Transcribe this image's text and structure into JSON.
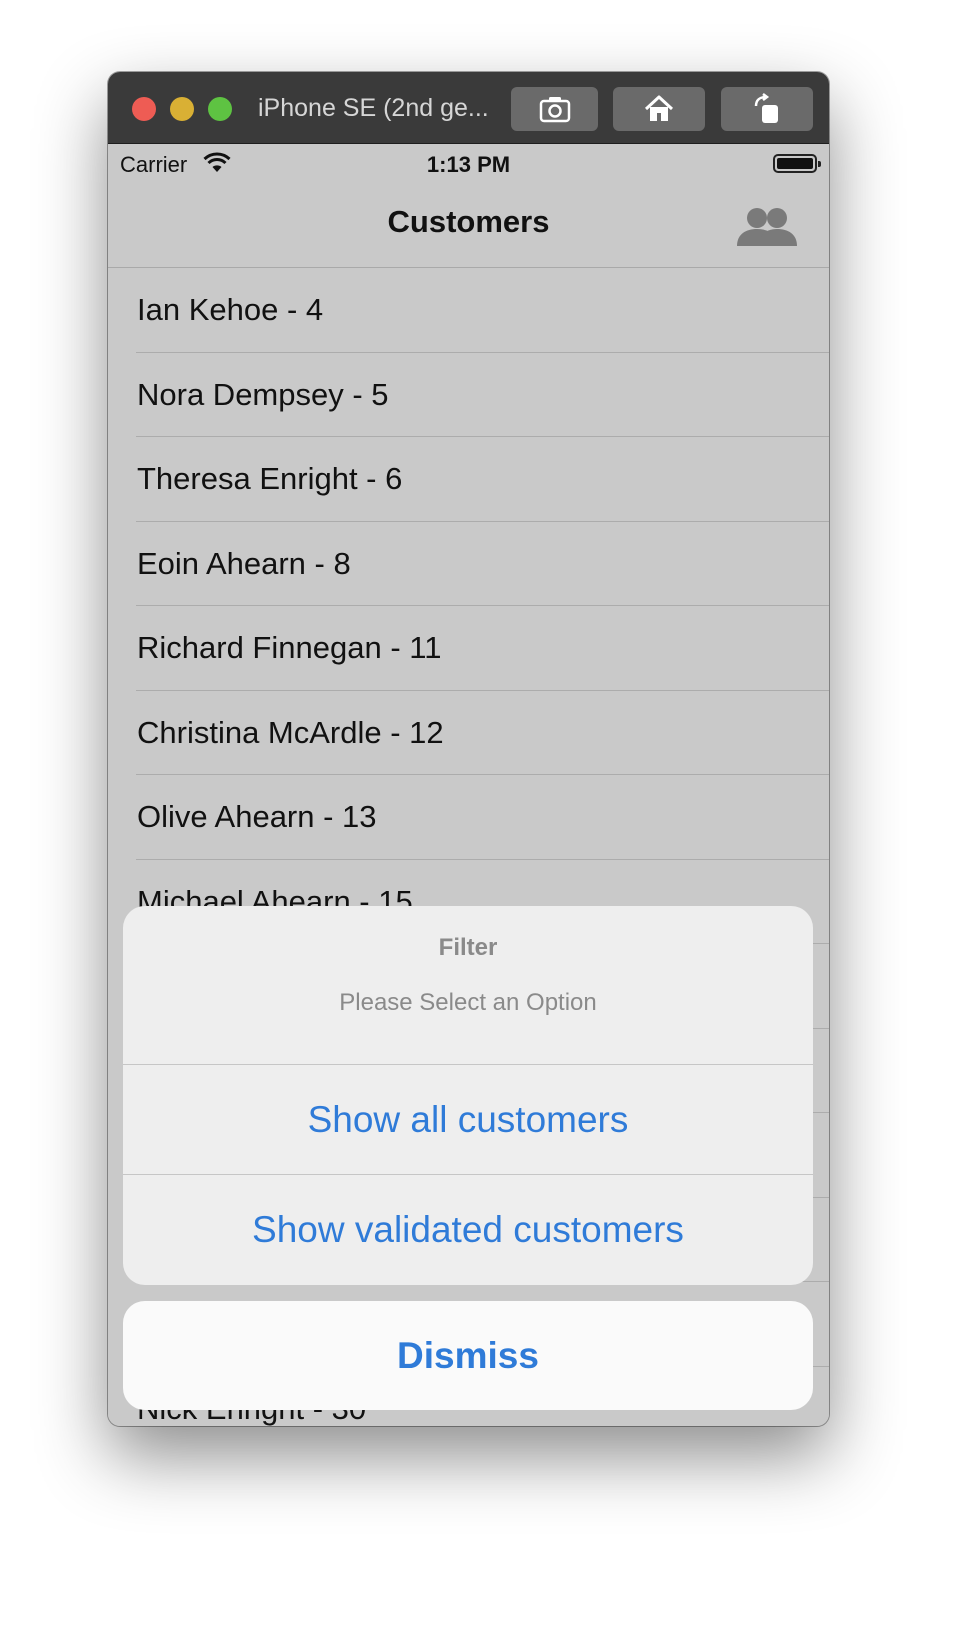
{
  "window": {
    "title": "iPhone SE (2nd ge..."
  },
  "toolbar": {
    "screenshot_icon": "camera-icon",
    "home_icon": "home-icon",
    "rotate_icon": "rotate-icon"
  },
  "statusbar": {
    "carrier": "Carrier",
    "time": "1:13 PM"
  },
  "navbar": {
    "title": "Customers",
    "icon": "people-icon"
  },
  "customers": [
    "Ian Kehoe - 4",
    "Nora Dempsey - 5",
    "Theresa Enright - 6",
    "Eoin Ahearn - 8",
    "Richard Finnegan - 11",
    "Christina McArdle - 12",
    "Olive Ahearn - 13",
    "Michael Ahearn - 15",
    "",
    "",
    "",
    "",
    "",
    "Nick Enright - 30"
  ],
  "action_sheet": {
    "title": "Filter",
    "message": "Please Select an Option",
    "actions": [
      "Show all customers",
      "Show validated customers"
    ],
    "cancel": "Dismiss"
  },
  "colors": {
    "accent": "#2f7bd8",
    "screen_dim": "#c9c9c9"
  }
}
